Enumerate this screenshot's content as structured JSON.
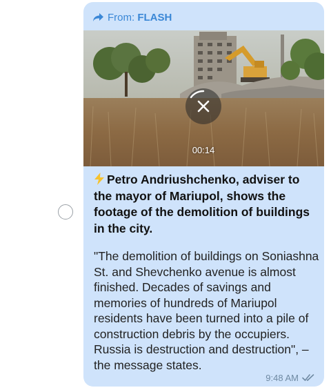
{
  "message": {
    "forward_label": "From: ",
    "forward_source": "FLASH",
    "video": {
      "duration": "00:14",
      "state": "downloading"
    },
    "headline": "Petro Andriushchenko, adviser to the mayor of Mariupol, shows the footage of the demolition of buildings in the city.",
    "body": "\"The demolition of buildings on Soniashna St. and Shevchenko avenue is almost finished. Decades of savings and memories of hundreds of Mariupol residents have been turned into a pile of construction debris by the occupiers. Russia is destruction and destruction\", – the message states.",
    "time": "9:48 AM",
    "status_icon": "double-check-icon"
  },
  "colors": {
    "bubble": "#cfe3fb",
    "accent": "#3a87d6",
    "meta": "#6f8aa3"
  }
}
